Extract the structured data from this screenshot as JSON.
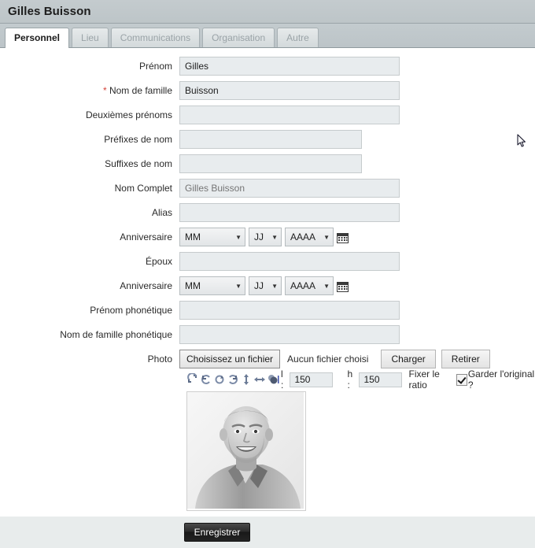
{
  "header": {
    "title": "Gilles Buisson"
  },
  "tabs": [
    {
      "label": "Personnel",
      "active": true
    },
    {
      "label": "Lieu",
      "active": false
    },
    {
      "label": "Communications",
      "active": false
    },
    {
      "label": "Organisation",
      "active": false
    },
    {
      "label": "Autre",
      "active": false
    }
  ],
  "form": {
    "prenom": {
      "label": "Prénom",
      "value": "Gilles",
      "placeholder": ""
    },
    "nom_famille": {
      "label": "Nom de famille",
      "value": "Buisson",
      "placeholder": "",
      "required_marker": "*"
    },
    "deuxiemes_prenoms": {
      "label": "Deuxièmes prénoms",
      "value": "",
      "placeholder": ""
    },
    "prefixes_nom": {
      "label": "Préfixes de nom",
      "value": "",
      "placeholder": ""
    },
    "suffixes_nom": {
      "label": "Suffixes de nom",
      "value": "",
      "placeholder": ""
    },
    "nom_complet": {
      "label": "Nom Complet",
      "value": "",
      "placeholder": "Gilles Buisson"
    },
    "alias": {
      "label": "Alias",
      "value": "",
      "placeholder": ""
    },
    "anniversaire": {
      "label": "Anniversaire"
    },
    "epoux": {
      "label": "Époux",
      "value": "",
      "placeholder": ""
    },
    "anniversaire_epoux": {
      "label": "Anniversaire"
    },
    "prenom_phonetique": {
      "label": "Prénom phonétique",
      "value": "",
      "placeholder": ""
    },
    "nom_phonetique": {
      "label": "Nom de famille phonétique",
      "value": "",
      "placeholder": ""
    },
    "photo": {
      "label": "Photo"
    }
  },
  "date_select": {
    "month": "MM",
    "day": "JJ",
    "year": "AAAA",
    "caret": "▼",
    "calendar_icon": "calendar-icon"
  },
  "photo_controls": {
    "choose_file_label": "Choisissez un fichier",
    "no_file_text": "Aucun fichier choisi",
    "upload_label": "Charger",
    "remove_label": "Retirer",
    "width_label": "l :",
    "width_value": "150",
    "height_label": "h :",
    "height_value": "150",
    "fix_ratio_label": "Fixer le ratio",
    "keep_original_label": "Garder l'original ?",
    "keep_original_checked": true,
    "tool_icons": [
      "rotate-left-icon",
      "rotate-ccw-icon",
      "rotate-cw-icon",
      "rotate-right-icon",
      "flip-vertical-icon",
      "flip-horizontal-icon",
      "grayscale-icon"
    ]
  },
  "footer": {
    "save_label": "Enregistrer"
  },
  "colors": {
    "header_band": "#bec6c9",
    "tab_active_bg": "#ffffff",
    "tab_inactive_text": "#9aa3a7",
    "field_bg": "#e8ecee",
    "required_asterisk": "#d4433a",
    "footer_bg": "#e8ecec",
    "save_button_bg": "#232323"
  }
}
